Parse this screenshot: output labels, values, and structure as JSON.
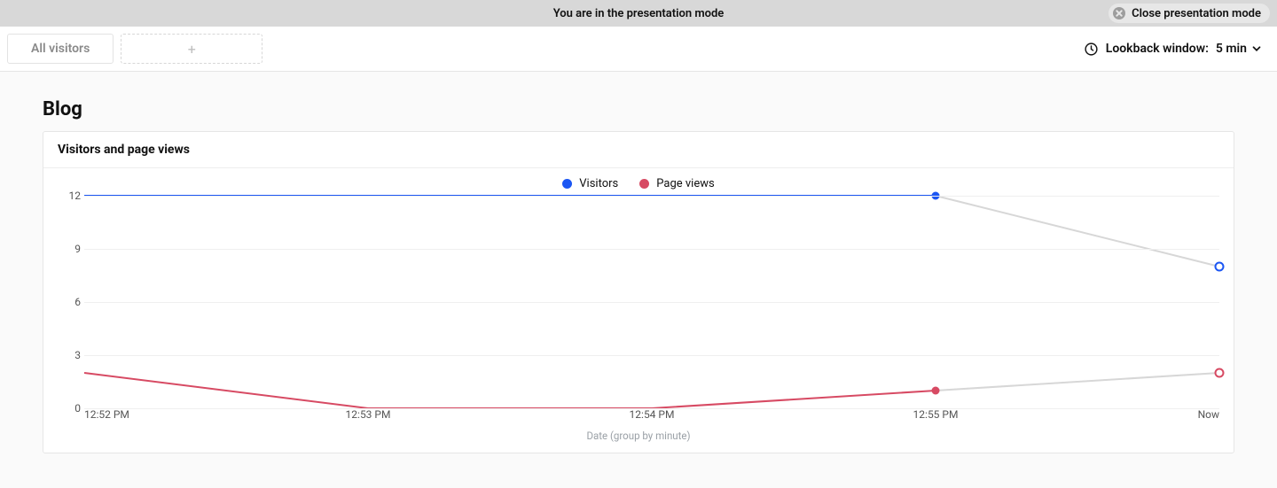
{
  "banner": {
    "message": "You are in the presentation mode",
    "close_label": "Close presentation mode"
  },
  "filters": {
    "chip_label": "All visitors"
  },
  "lookback": {
    "label": "Lookback window:",
    "value": "5 min"
  },
  "page": {
    "title": "Blog"
  },
  "card": {
    "title": "Visitors and page views"
  },
  "legend": {
    "visitors": "Visitors",
    "page_views": "Page views"
  },
  "colors": {
    "visitors": "#1b56f3",
    "page_views": "#d74a63",
    "future": "#d7d7d7"
  },
  "chart_data": {
    "type": "line",
    "xlabel": "Date (group by minute)",
    "ylabel": "",
    "ylim": [
      0,
      12
    ],
    "y_ticks": [
      0,
      3,
      6,
      9,
      12
    ],
    "categories": [
      "12:52 PM",
      "12:53 PM",
      "12:54 PM",
      "12:55 PM",
      "Now"
    ],
    "series": [
      {
        "name": "Visitors",
        "values": [
          12,
          12,
          12,
          12,
          8
        ],
        "realtime_last": true
      },
      {
        "name": "Page views",
        "values": [
          2,
          0,
          0,
          1,
          2
        ],
        "realtime_last": true
      }
    ]
  }
}
